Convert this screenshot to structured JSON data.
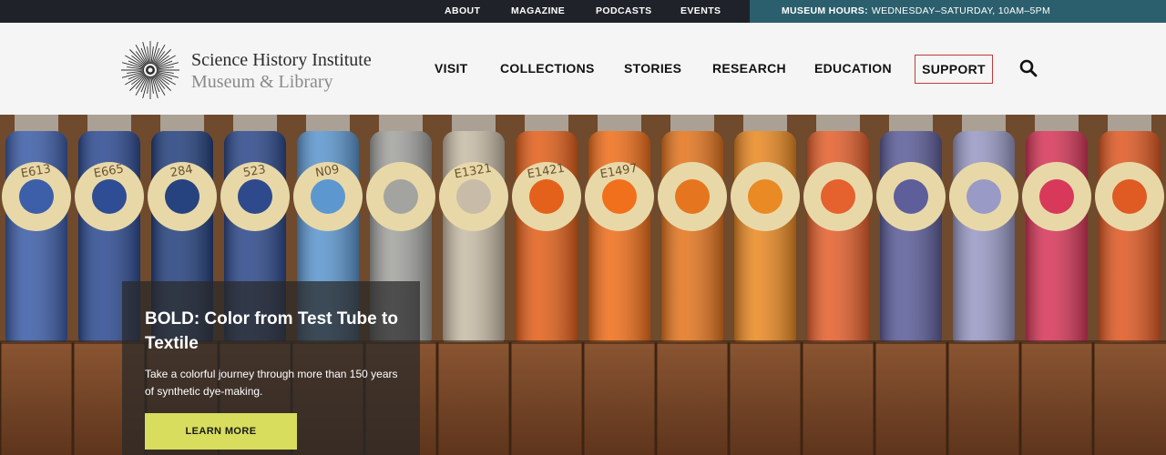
{
  "utility_nav": {
    "items": [
      {
        "label": "ABOUT"
      },
      {
        "label": "MAGAZINE"
      },
      {
        "label": "PODCASTS"
      },
      {
        "label": "EVENTS"
      }
    ],
    "hours": {
      "label": "MUSEUM HOURS:",
      "value": "WEDNESDAY–SATURDAY, 10AM–5PM"
    }
  },
  "brand": {
    "name_line1": "Science History Institute",
    "name_line2": "Museum & Library",
    "icon": "starburst-logo-icon"
  },
  "main_nav": {
    "items": [
      {
        "label": "VISIT"
      },
      {
        "label": "COLLECTIONS"
      },
      {
        "label": "STORIES"
      },
      {
        "label": "RESEARCH"
      },
      {
        "label": "EDUCATION"
      }
    ],
    "support_label": "SUPPORT",
    "search_icon": "search-icon"
  },
  "hero": {
    "title": "BOLD: Color from Test Tube to Textile",
    "description": "Take a colorful journey through more than 150 years of synthetic dye-making.",
    "cta_label": "LEARN MORE",
    "tube_labels": [
      "E613",
      "E665",
      "284",
      "523",
      "N09",
      "",
      "E1321",
      "E1421",
      "E1497"
    ]
  },
  "colors": {
    "utility_bar": "#1f2329",
    "hours_banner": "#2c5f6d",
    "support_border": "#c23a3a",
    "cta_button": "#d8dd5e",
    "header_bg": "#f5f5f5"
  }
}
